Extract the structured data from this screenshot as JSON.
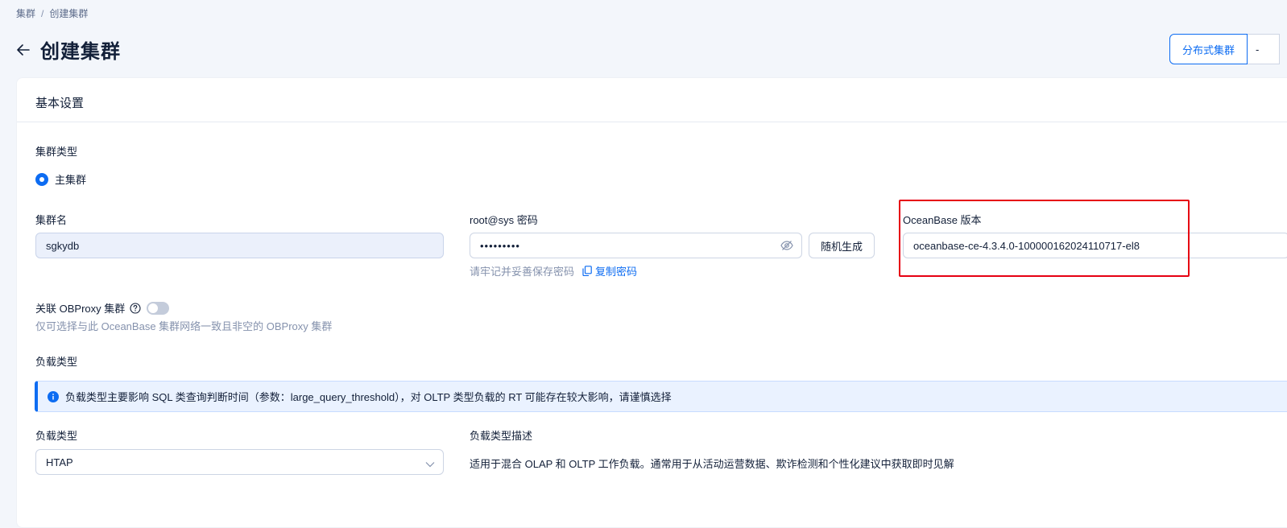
{
  "breadcrumb": {
    "root": "集群",
    "separator": "/",
    "current": "创建集群"
  },
  "header": {
    "title": "创建集群"
  },
  "toolbar": {
    "distributed_label": "分布式集群",
    "next_label": "-"
  },
  "card": {
    "title": "基本设置",
    "cluster_type": {
      "label": "集群类型",
      "option": "主集群"
    },
    "cluster_name": {
      "label": "集群名",
      "value": "sgkydb"
    },
    "password": {
      "label": "root@sys 密码",
      "value": "•••••••••",
      "generate_label": "随机生成",
      "hint": "请牢记并妥善保存密码",
      "copy_label": "复制密码"
    },
    "version": {
      "label": "OceanBase 版本",
      "value": "oceanbase-ce-4.3.4.0-100000162024110717-el8"
    },
    "obproxy": {
      "label": "关联 OBProxy 集群",
      "hint": "仅可选择与此 OceanBase 集群网络一致且非空的 OBProxy 集群",
      "enabled": false
    },
    "workload": {
      "section_label": "负载类型",
      "alert": "负载类型主要影响 SQL 类查询判断时间（参数：large_query_threshold），对 OLTP 类型负载的 RT 可能存在较大影响，请谨慎选择",
      "select_label": "负载类型",
      "select_value": "HTAP",
      "desc_label": "负载类型描述",
      "desc_value": "适用于混合 OLAP 和 OLTP 工作负载。通常用于从活动运营数据、欺诈检测和个性化建议中获取即时见解"
    }
  },
  "colors": {
    "primary": "#0d6cf2",
    "highlight_border": "#e60012",
    "alert_bg": "#eaf2ff"
  }
}
